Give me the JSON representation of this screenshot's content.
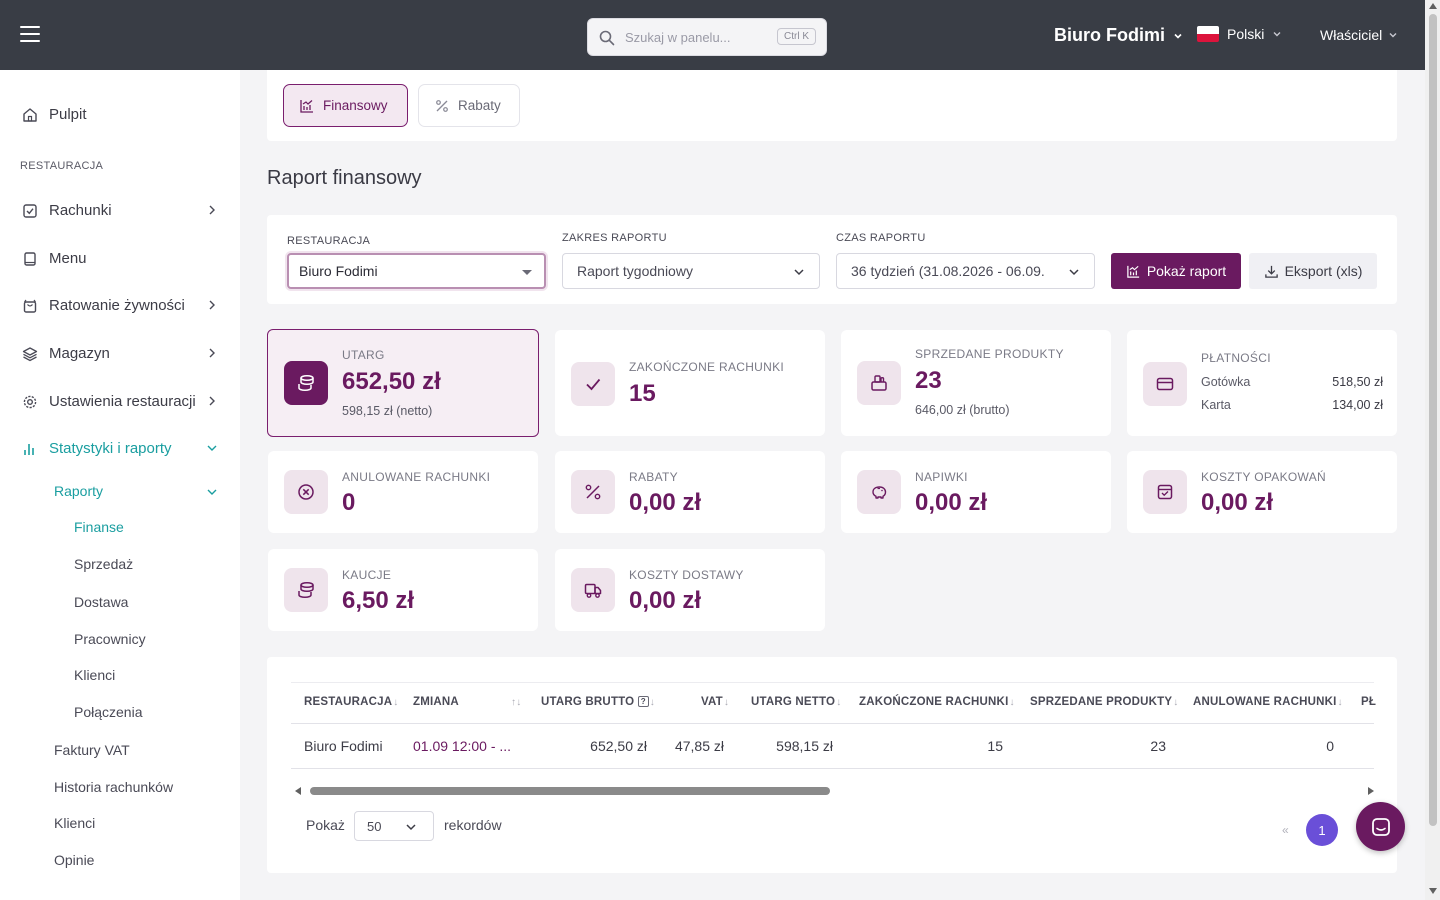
{
  "header": {
    "search_placeholder": "Szukaj w panelu...",
    "search_shortcut": "Ctrl K",
    "org_name": "Biuro Fodimi",
    "language": "Polski",
    "role": "Właściciel"
  },
  "sidebar": {
    "dashboard": "Pulpit",
    "section_label": "RESTAURACJA",
    "items": [
      {
        "label": "Rachunki"
      },
      {
        "label": "Menu"
      },
      {
        "label": "Ratowanie żywności"
      },
      {
        "label": "Magazyn"
      },
      {
        "label": "Ustawienia restauracji"
      },
      {
        "label": "Statystyki i raporty"
      }
    ],
    "reports_label": "Raporty",
    "report_subitems": [
      "Finanse",
      "Sprzedaż",
      "Dostawa",
      "Pracownicy",
      "Klienci",
      "Połączenia"
    ],
    "other_items": [
      "Faktury VAT",
      "Historia rachunków",
      "Klienci",
      "Opinie"
    ]
  },
  "tabs": {
    "financial": "Finansowy",
    "discounts": "Rabaty"
  },
  "page_title": "Raport finansowy",
  "filters": {
    "restaurant_label": "RESTAURACJA",
    "restaurant_value": "Biuro Fodimi",
    "range_label": "ZAKRES RAPORTU",
    "range_value": "Raport tygodniowy",
    "time_label": "CZAS RAPORTU",
    "time_value": "36 tydzień (31.08.2026 - 06.09.",
    "show_report": "Pokaż raport",
    "export": "Eksport (xls)"
  },
  "stats": {
    "revenue": {
      "label": "UTARG",
      "value": "652,50 zł",
      "sub": "598,15 zł (netto)"
    },
    "completed": {
      "label": "ZAKOŃCZONE RACHUNKI",
      "value": "15"
    },
    "sold": {
      "label": "SPRZEDANE PRODUKTY",
      "value": "23",
      "sub": "646,00 zł (brutto)"
    },
    "payments": {
      "label": "PŁATNOŚCI",
      "cash_label": "Gotówka",
      "cash_value": "518,50 zł",
      "card_label": "Karta",
      "card_value": "134,00 zł"
    },
    "cancelled": {
      "label": "ANULOWANE RACHUNKI",
      "value": "0"
    },
    "discounts": {
      "label": "RABATY",
      "value": "0,00 zł"
    },
    "tips": {
      "label": "NAPIWKI",
      "value": "0,00 zł"
    },
    "packaging": {
      "label": "KOSZTY OPAKOWAŃ",
      "value": "0,00 zł"
    },
    "deposits": {
      "label": "KAUCJE",
      "value": "6,50 zł"
    },
    "delivery": {
      "label": "KOSZTY DOSTAWY",
      "value": "0,00 zł"
    }
  },
  "table": {
    "headers": [
      "RESTAURACJA",
      "ZMIANA",
      "UTARG BRUTTO",
      "VAT",
      "UTARG NETTO",
      "ZAKOŃCZONE RACHUNKI",
      "SPRZEDANE PRODUKTY",
      "ANULOWANE RACHUNKI",
      "PŁ"
    ],
    "row": {
      "restaurant": "Biuro Fodimi",
      "shift": "01.09 12:00 - ...",
      "gross": "652,50 zł",
      "vat": "47,85 zł",
      "net": "598,15 zł",
      "completed": "15",
      "sold": "23",
      "cancelled": "0"
    },
    "show_label": "Pokaż",
    "page_size": "50",
    "records_label": "rekordów",
    "prev": "«",
    "page": "1"
  },
  "colors": {
    "primary": "#6a1a60",
    "accent_teal": "#1a9ea0",
    "topbar": "#393d45",
    "page_active": "#6a4fd8"
  }
}
